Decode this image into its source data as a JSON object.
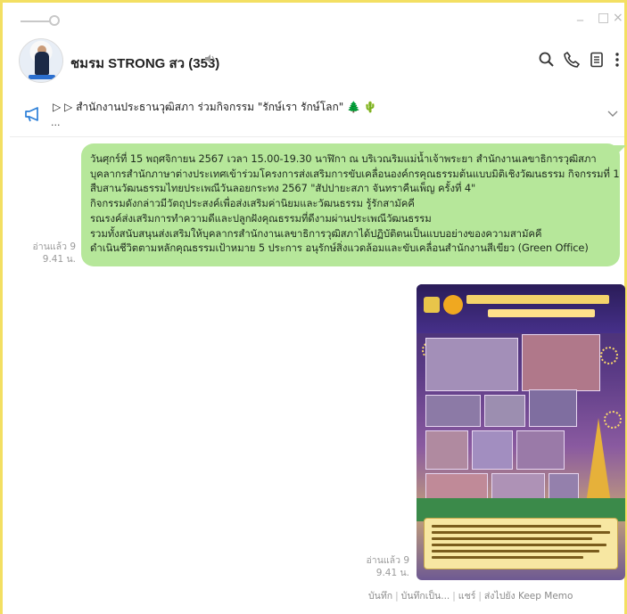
{
  "window": {
    "minimize": "_",
    "maximize": "□",
    "close": "×"
  },
  "header": {
    "chat_title": "ชมรม STRONG สว (353)",
    "icons": [
      "search-icon",
      "phone-icon",
      "note-icon",
      "more-icon",
      "mute-icon"
    ]
  },
  "announcement": {
    "text": "▷ ▷ สำนักงานประธานวุฒิสภา ร่วมกิจกรรม \"รักษ์เรา รักษ์โลก\" 🌲 🌵",
    "more": "..."
  },
  "message": {
    "lines": [
      "วันศุกร์ที่ 15 พฤศจิกายน 2567 เวลา 15.00-19.30 นาฬิกา ณ บริเวณริมแม่น้ำเจ้าพระยา สำนักงานเลขาธิการวุฒิสภา",
      "บุคลากรสำนักภาษาต่างประเทศเข้าร่วมโครงการส่งเสริมการขับเคลื่อนองค์กรคุณธรรมต้นแบบมิติเชิงวัฒนธรรม กิจกรรมที่ 1",
      "สืบสานวัฒนธรรมไทยประเพณีวันลอยกระทง 2567 \"สัปปายะสภา จันทราคืนเพ็ญ ครั้งที่ 4\"",
      "กิจกรรมดังกล่าวมีวัตถุประสงค์เพื่อส่งเสริมค่านิยมและวัฒนธรรม รู้รักสามัคคี",
      "รณรงค์ส่งเสริมการทำความดีและปลูกฝังคุณธรรมที่ดีงามผ่านประเพณีวัฒนธรรม",
      "รวมทั้งสนับสนุนส่งเสริมให้บุคลากรสำนักงานเลขาธิการวุฒิสภาได้ปฏิบัติตนเป็นแบบอย่างของความสามัคคี",
      "ดำเนินชีวิตตามหลักคุณธรรมเป้าหมาย 5 ประการ อนุรักษ์สิ่งแวดล้อมและขับเคลื่อนสำนักงานสีเขียว (Green Office)"
    ],
    "read_label": "อ่านแล้ว 9",
    "time": "9.41 น."
  },
  "image_message": {
    "read_label": "อ่านแล้ว 9",
    "time": "9.41 น."
  },
  "actions": {
    "save": "บันทึก",
    "save_as": "บันทึกเป็น...",
    "share": "แชร์",
    "keep": "ส่งไปยัง Keep Memo"
  },
  "colors": {
    "bubble": "#b6e79a",
    "frame": "#f3df62",
    "announce_icon": "#2c7fd8"
  }
}
